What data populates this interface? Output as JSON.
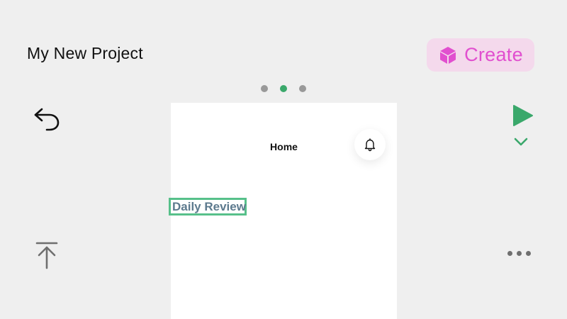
{
  "header": {
    "project_title": "My New Project",
    "create_label": "Create"
  },
  "colors": {
    "background": "#efefef",
    "create_bg": "#f4d9ec",
    "create_accent": "#e14fcf",
    "green_accent": "#3aa86b",
    "selection_border": "#57c08a"
  },
  "pager": {
    "count": 3,
    "active_index": 1
  },
  "toolbar_icons": [
    "undo-icon",
    "play-icon",
    "chevron-down-icon",
    "upload-to-top-icon",
    "more-icon"
  ],
  "canvas": {
    "home_title": "Home",
    "bell_icon": "bell-icon",
    "selected_text": "Daily Review"
  }
}
